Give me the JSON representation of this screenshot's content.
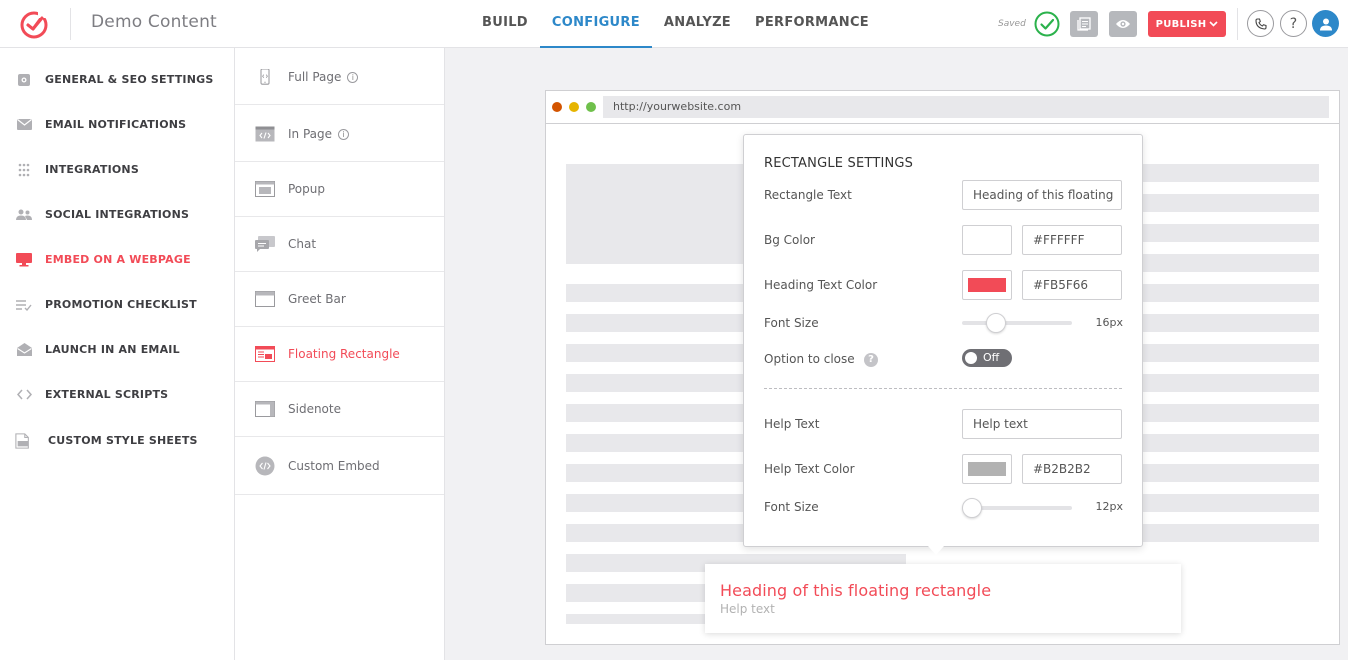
{
  "app": {
    "title": "Demo Content",
    "saved_label": "Saved",
    "publish_label": "PUBLISH"
  },
  "nav": {
    "items": [
      {
        "label": "BUILD",
        "active": false
      },
      {
        "label": "CONFIGURE",
        "active": true
      },
      {
        "label": "ANALYZE",
        "active": false
      },
      {
        "label": "PERFORMANCE",
        "active": false
      }
    ]
  },
  "header_icons": {
    "help_glyph": "?"
  },
  "sidebar": {
    "items": [
      {
        "label": "GENERAL & SEO SETTINGS",
        "icon": "gear-icon",
        "active": false
      },
      {
        "label": "EMAIL NOTIFICATIONS",
        "icon": "envelope-icon",
        "active": false
      },
      {
        "label": "INTEGRATIONS",
        "icon": "grid-dots-icon",
        "active": false
      },
      {
        "label": "SOCIAL INTEGRATIONS",
        "icon": "people-icon",
        "active": false
      },
      {
        "label": "EMBED ON A WEBPAGE",
        "icon": "monitor-icon",
        "active": true
      },
      {
        "label": "PROMOTION CHECKLIST",
        "icon": "checklist-icon",
        "active": false
      },
      {
        "label": "LAUNCH IN AN EMAIL",
        "icon": "open-envelope-icon",
        "active": false
      },
      {
        "label": "EXTERNAL SCRIPTS",
        "icon": "code-brackets-icon",
        "active": false
      },
      {
        "label": "CUSTOM STYLE SHEETS",
        "icon": "css-file-icon",
        "active": false
      }
    ]
  },
  "embed_types": {
    "items": [
      {
        "label": "Full Page",
        "icon": "mobile-page-icon",
        "info": true,
        "active": false
      },
      {
        "label": "In Page",
        "icon": "code-window-icon",
        "info": true,
        "active": false
      },
      {
        "label": "Popup",
        "icon": "popup-window-icon",
        "info": false,
        "active": false
      },
      {
        "label": "Chat",
        "icon": "chat-bubbles-icon",
        "info": false,
        "active": false
      },
      {
        "label": "Greet Bar",
        "icon": "greet-bar-icon",
        "info": false,
        "active": false
      },
      {
        "label": "Floating Rectangle",
        "icon": "floating-rectangle-icon",
        "info": false,
        "active": true
      },
      {
        "label": "Sidenote",
        "icon": "sidenote-icon",
        "info": false,
        "active": false
      },
      {
        "label": "Custom Embed",
        "icon": "custom-embed-icon",
        "info": false,
        "active": false
      }
    ],
    "info_glyph": "i"
  },
  "preview": {
    "url": "http://yourwebsite.com",
    "dot_colors": [
      "#d35400",
      "#e6b400",
      "#6fc04b"
    ]
  },
  "settings": {
    "title": "RECTANGLE SETTINGS",
    "rectangle_text_label": "Rectangle Text",
    "rectangle_text_value": "Heading of this floating",
    "bg_color_label": "Bg Color",
    "bg_color_value": "#FFFFFF",
    "heading_color_label": "Heading Text Color",
    "heading_color_value": "#FB5F66",
    "heading_swatch": "#f24b57",
    "font_size_label": "Font Size",
    "font_size_value": "16px",
    "font_size_fraction": 0.27,
    "close_label": "Option to close",
    "close_help_glyph": "?",
    "close_toggle": "Off",
    "help_text_label": "Help Text",
    "help_text_value": "Help text",
    "help_color_label": "Help Text Color",
    "help_color_value": "#B2B2B2",
    "help_swatch": "#b2b2b2",
    "help_font_size_label": "Font Size",
    "help_font_size_value": "12px",
    "help_font_size_fraction": 0.0
  },
  "floating_rectangle": {
    "heading": "Heading of this floating rectangle",
    "help_text": "Help text"
  },
  "colors": {
    "accent_blue": "#2d88c9",
    "brand_red": "#f24b57",
    "saved_green": "#2bb24c"
  }
}
